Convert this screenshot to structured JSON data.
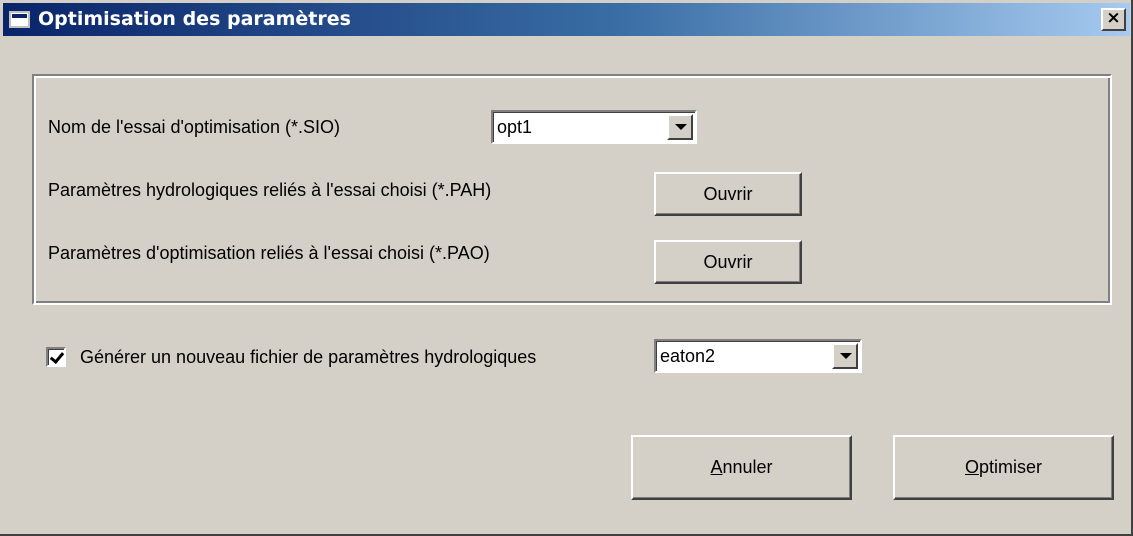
{
  "window": {
    "title": "Optimisation des paramètres",
    "close_glyph": "×"
  },
  "group": {
    "trial_label": "Nom de l'essai d'optimisation (*.SIO)",
    "trial_value": "opt1",
    "hydro_label": "Paramètres hydrologiques reliés à l'essai choisi (*.PAH)",
    "hydro_button": "Ouvrir",
    "optim_label": "Paramètres d'optimisation reliés à l'essai choisi (*.PAO)",
    "optim_button": "Ouvrir"
  },
  "generate": {
    "checked": true,
    "label": "Générer un nouveau fichier de paramètres hydrologiques",
    "file_value": "eaton2"
  },
  "actions": {
    "cancel_mnemonic": "A",
    "cancel_rest": "nnuler",
    "optimize_mnemonic": "O",
    "optimize_rest": "ptimiser"
  }
}
